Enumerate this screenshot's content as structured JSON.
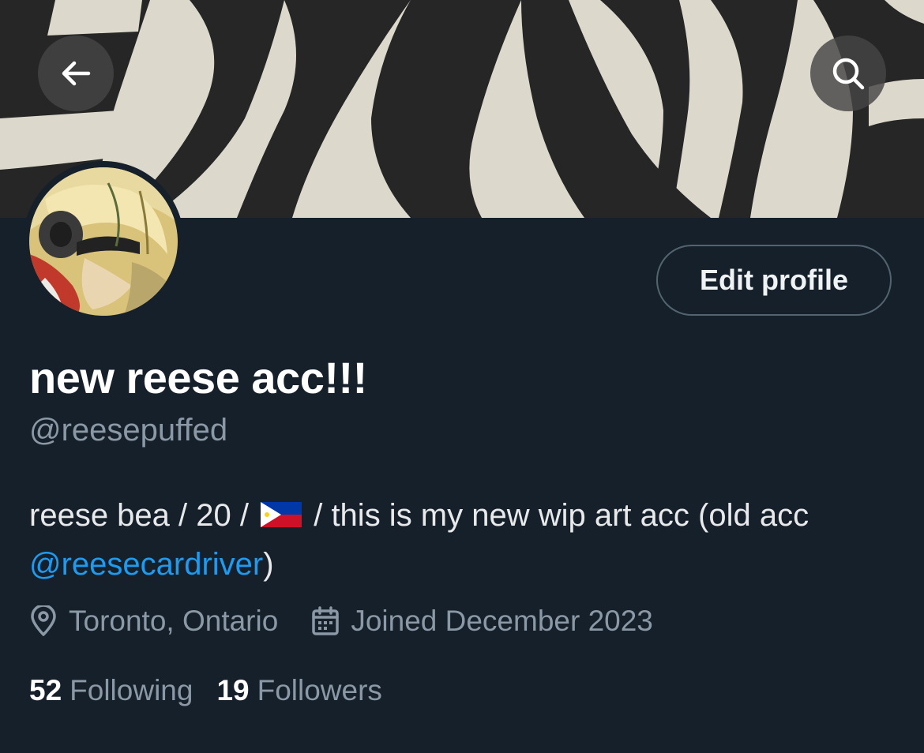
{
  "header": {
    "back_icon": "arrow-left-icon",
    "search_icon": "search-icon"
  },
  "profile": {
    "display_name": "new reese acc!!!",
    "handle": "@reesepuffed",
    "edit_label": "Edit profile",
    "bio": {
      "part1": "reese bea / 20 /",
      "flag": "philippines-flag",
      "part2": "/ this is my new wip art acc (old acc",
      "mention": "@reesecardriver",
      "part3": ")"
    },
    "location": "Toronto, Ontario",
    "joined": "Joined December 2023",
    "following_count": "52",
    "following_label": "Following",
    "followers_count": "19",
    "followers_label": "Followers"
  },
  "colors": {
    "background": "#15202b",
    "accent": "#1d9bf0",
    "secondary_text": "#8b98a5",
    "border": "#536471"
  }
}
